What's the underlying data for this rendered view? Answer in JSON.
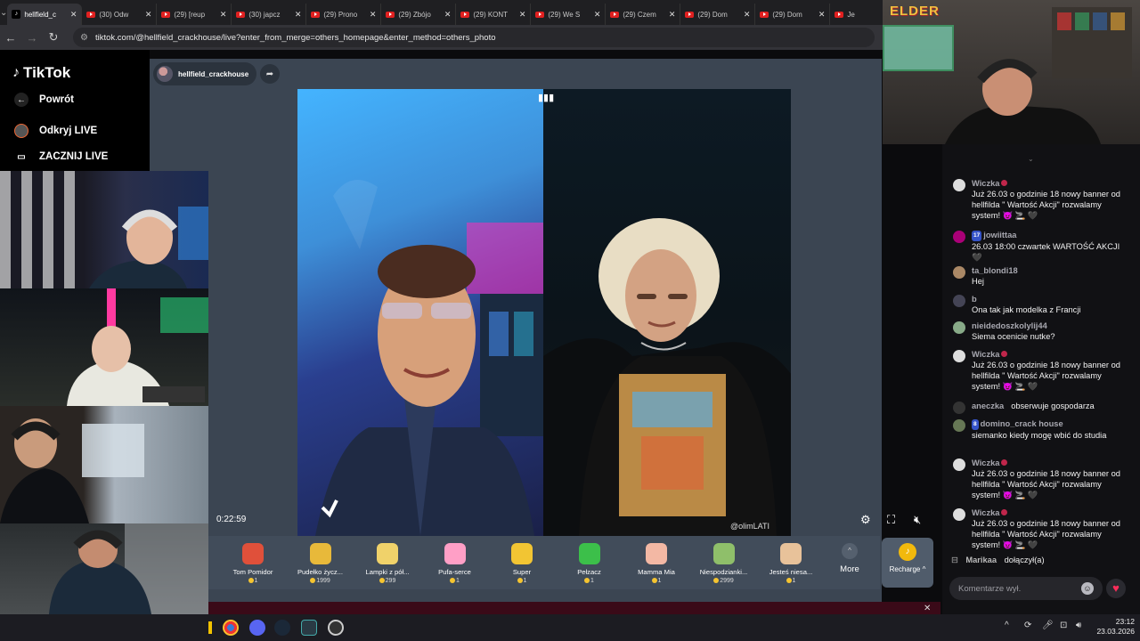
{
  "browser": {
    "tabs": [
      {
        "label": "hellfield_c",
        "icon": "tiktok",
        "active": true
      },
      {
        "label": "(30) Odw",
        "icon": "youtube"
      },
      {
        "label": "(29) [reup",
        "icon": "youtube"
      },
      {
        "label": "(30) japcz",
        "icon": "youtube"
      },
      {
        "label": "(29) Prono",
        "icon": "youtube"
      },
      {
        "label": "(29) Zbójo",
        "icon": "youtube"
      },
      {
        "label": "(29) KONT",
        "icon": "youtube"
      },
      {
        "label": "(29) We S",
        "icon": "youtube"
      },
      {
        "label": "(29) Czem",
        "icon": "youtube"
      },
      {
        "label": "(29) Dom",
        "icon": "youtube"
      },
      {
        "label": "(29) Dom",
        "icon": "youtube"
      },
      {
        "label": "Je",
        "icon": "youtube"
      }
    ],
    "url": "tiktok.com/@hellfield_crackhouse/live?enter_from_merge=others_homepage&enter_method=others_photo"
  },
  "sidebar": {
    "logo": "TikTok",
    "back": "Powrót",
    "discover": "Odkryj LIVE",
    "start": "ZACZNIJ LIVE"
  },
  "stream": {
    "host": "hellfield_crackhouse",
    "elapsed": "0:22:59",
    "watermark": "@olimLATI"
  },
  "gifts": [
    {
      "name": "Tom Pomidor",
      "price": "1",
      "color": "#e0503a"
    },
    {
      "name": "Pudełko życz...",
      "price": "1999",
      "color": "#e8b93a"
    },
    {
      "name": "Lampki z pół...",
      "price": "299",
      "color": "#f0d26a"
    },
    {
      "name": "Pufa-serce",
      "price": "1",
      "color": "#ff9fc6"
    },
    {
      "name": "Super",
      "price": "1",
      "color": "#f2c533"
    },
    {
      "name": "Pełzacz",
      "price": "1",
      "color": "#3cbf4a"
    },
    {
      "name": "Mamma Mia",
      "price": "1",
      "color": "#f3b8a4"
    },
    {
      "name": "Niespodzianki...",
      "price": "2999",
      "color": "#8fbf6a"
    },
    {
      "name": "Jesteś niesa...",
      "price": "1",
      "color": "#e8c29a"
    }
  ],
  "gift_controls": {
    "more": "More",
    "recharge": "Recharge"
  },
  "chat": {
    "messages": [
      {
        "user": "Wiczka",
        "text": "Już 26.03 o godzinie 18 nowy banner od hellfilda \" Wartość Akcji\" rozwalamy system! 😈 🚬 🖤",
        "badge": "",
        "heart": true
      },
      {
        "user": "jowiittaa",
        "text": "26.03 18:00 czwartek WARTOŚĆ AKCJI 🖤",
        "badge": "17",
        "heart": false
      },
      {
        "user": "ta_blondi18",
        "text": "Hej",
        "badge": "",
        "heart": false
      },
      {
        "user": "b",
        "text": "Ona tak jak modelka z Francji",
        "badge": "",
        "heart": false
      },
      {
        "user": "nieidedoszkolylij44",
        "text": "Siema ocenicie nutke?",
        "badge": "",
        "heart": false
      },
      {
        "user": "Wiczka",
        "text": "Już 26.03 o godzinie 18 nowy banner od hellfilda \" Wartość Akcji\" rozwalamy system! 😈 🚬 🖤",
        "badge": "",
        "heart": true
      },
      {
        "user": "aneczka",
        "text": "obserwuje gospodarza",
        "badge": "",
        "heart": false
      },
      {
        "user": "domino_crack house",
        "text": "siemanko kiedy mogę wbić do studia",
        "badge": "8",
        "heart": false
      },
      {
        "user": "Wiczka",
        "text": "Już 26.03 o godzinie 18 nowy banner od hellfilda \" Wartość Akcji\" rozwalamy system! 😈 🚬 🖤",
        "badge": "",
        "heart": true
      },
      {
        "user": "Wiczka",
        "text": "Już 26.03 o godzinie 18 nowy banner od hellfilda \" Wartość Akcji\" rozwalamy system! 😈 🚬 🖤",
        "badge": "",
        "heart": true
      }
    ],
    "join_user": "Marikaa",
    "join_text": "dołączył(a)",
    "input_placeholder": "Komentarze wył."
  },
  "overlay": {
    "elder_logo": "ELDER"
  },
  "taskbar": {
    "time": "23:12",
    "date": "23.03.2026"
  }
}
